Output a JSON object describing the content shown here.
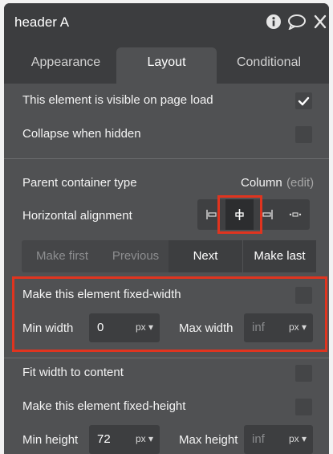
{
  "header": {
    "title": "header A"
  },
  "tabs": [
    {
      "label": "Appearance",
      "active": false
    },
    {
      "label": "Layout",
      "active": true
    },
    {
      "label": "Conditional",
      "active": false
    }
  ],
  "visibility": {
    "visible_on_load_label": "This element is visible on page load",
    "visible_on_load_checked": true,
    "collapse_label": "Collapse when hidden",
    "collapse_checked": false
  },
  "container": {
    "parent_type_label": "Parent container type",
    "parent_type_value": "Column",
    "edit_label": "(edit)"
  },
  "alignment": {
    "label": "Horizontal alignment",
    "options": [
      "align-left-icon",
      "align-center-icon",
      "align-right-icon",
      "align-space-icon"
    ],
    "selected": "align-center-icon"
  },
  "ordering": {
    "make_first": "Make first",
    "previous": "Previous",
    "next": "Next",
    "make_last": "Make last"
  },
  "width": {
    "fixed_label": "Make this element fixed-width",
    "fixed_checked": false,
    "min_label": "Min width",
    "min_value": "0",
    "min_unit": "px",
    "max_label": "Max width",
    "max_placeholder": "inf",
    "max_unit": "px",
    "fit_label": "Fit width to content",
    "fit_checked": false
  },
  "height": {
    "fixed_label": "Make this element fixed-height",
    "fixed_checked": false,
    "min_label": "Min height",
    "min_value": "72",
    "min_unit": "px",
    "max_label": "Max height",
    "max_placeholder": "inf",
    "max_unit": "px"
  },
  "colors": {
    "panel": "#505153",
    "header": "#3c3d3f",
    "highlight": "#e0341f"
  }
}
